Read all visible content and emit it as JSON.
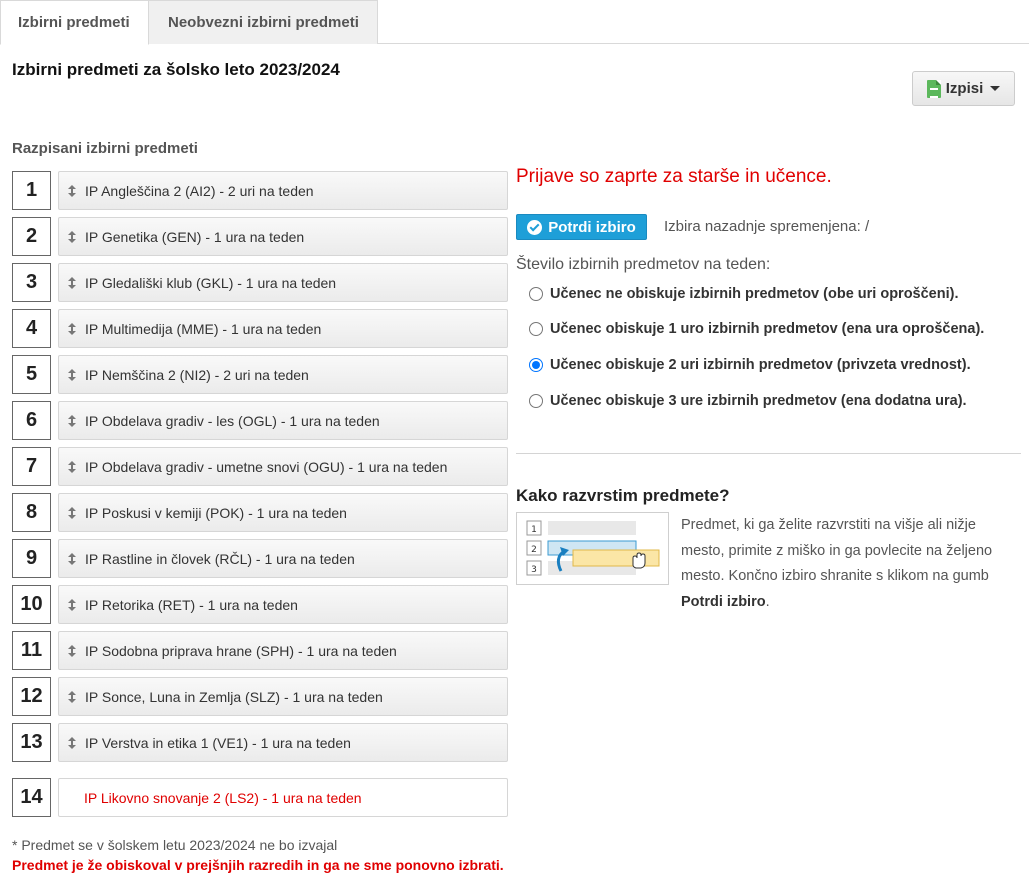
{
  "tabs": [
    {
      "label": "Izbirni predmeti"
    },
    {
      "label": "Neobvezni izbirni predmeti"
    }
  ],
  "page_title": "Izbirni predmeti za šolsko leto 2023/2024",
  "izpisi_label": "Izpisi",
  "section_label": "Razpisani izbirni predmeti",
  "subjects": [
    {
      "num": "1",
      "label": "IP Angleščina 2 (AI2) - 2 uri na teden"
    },
    {
      "num": "2",
      "label": "IP Genetika (GEN) - 1 ura na teden"
    },
    {
      "num": "3",
      "label": "IP Gledališki klub (GKL) - 1 ura na teden"
    },
    {
      "num": "4",
      "label": "IP Multimedija (MME) - 1 ura na teden"
    },
    {
      "num": "5",
      "label": "IP Nemščina 2 (NI2) - 2 uri na teden"
    },
    {
      "num": "6",
      "label": "IP Obdelava gradiv - les (OGL) - 1 ura na teden"
    },
    {
      "num": "7",
      "label": "IP Obdelava gradiv - umetne snovi (OGU) - 1 ura na teden"
    },
    {
      "num": "8",
      "label": "IP Poskusi v kemiji (POK) - 1 ura na teden"
    },
    {
      "num": "9",
      "label": "IP Rastline in človek (RČL) - 1 ura na teden"
    },
    {
      "num": "10",
      "label": "IP Retorika (RET) - 1 ura na teden"
    },
    {
      "num": "11",
      "label": "IP Sodobna priprava hrane (SPH) - 1 ura na teden"
    },
    {
      "num": "12",
      "label": "IP Sonce, Luna in Zemlja (SLZ) - 1 ura na teden"
    },
    {
      "num": "13",
      "label": "IP Verstva in etika 1 (VE1) - 1 ura na teden"
    }
  ],
  "extra_subject": {
    "num": "14",
    "label": "IP Likovno snovanje 2 (LS2) - 1 ura na teden"
  },
  "footnote": "* Predmet se v šolskem letu 2023/2024 ne bo izvajal",
  "footnote_red": "Predmet je že obiskoval v prejšnjih razredih in ga ne sme ponovno izbrati.",
  "closed_message": "Prijave so zaprte za starše in učence.",
  "confirm_label": "Potrdi izbiro",
  "last_changed": "Izbira nazadnje spremenjena: /",
  "count_label": "Število izbirnih predmetov na teden:",
  "options": [
    {
      "label": "Učenec ne obiskuje izbirnih predmetov (obe uri oproščeni).",
      "checked": false
    },
    {
      "label": "Učenec obiskuje 1 uro izbirnih predmetov (ena ura oproščena).",
      "checked": false
    },
    {
      "label": "Učenec obiskuje 2 uri izbirnih predmetov (privzeta vrednost).",
      "checked": true
    },
    {
      "label": "Učenec obiskuje 3 ure izbirnih predmetov (ena dodatna ura).",
      "checked": false
    }
  ],
  "help": {
    "title": "Kako razvrstim predmete?",
    "text_before": "Predmet, ki ga želite razvrstiti na višje ali nižje mesto, primite z miško in ga povlecite na željeno mesto. Končno izbiro shranite s klikom na gumb ",
    "text_bold": "Potrdi izbiro",
    "text_after": ".",
    "image_numbers": [
      "1",
      "2",
      "3"
    ]
  },
  "colors": {
    "accent": "#1e9fd8",
    "error": "#e00000",
    "radio": "#0075ff"
  }
}
